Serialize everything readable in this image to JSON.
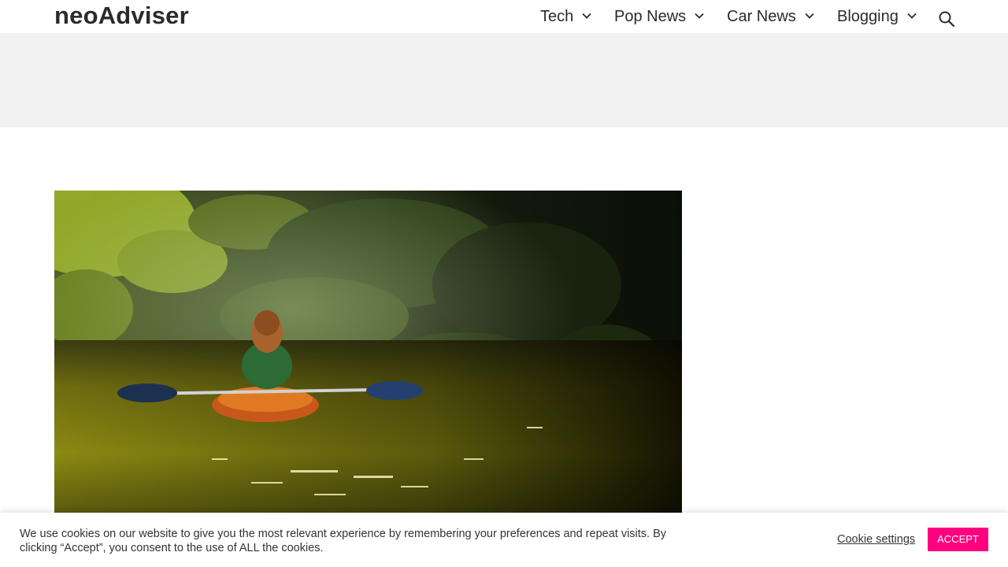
{
  "site": {
    "title": "neoAdviser"
  },
  "nav": {
    "items": [
      {
        "label": "Tech",
        "icon": "chevron-down-icon"
      },
      {
        "label": "Pop News",
        "icon": "chevron-down-icon"
      },
      {
        "label": "Car News",
        "icon": "chevron-down-icon"
      },
      {
        "label": "Blogging",
        "icon": "chevron-down-icon"
      }
    ],
    "search_icon": "search-icon"
  },
  "cookie": {
    "text": "We use cookies on our website to give you the most relevant experience by remembering your preferences and repeat visits. By clicking “Accept”, you consent to the use of ALL the cookies.",
    "settings_label": "Cookie settings",
    "accept_label": "ACCEPT",
    "accept_color": "#ff0080"
  },
  "colors": {
    "text": "#2b2b2b",
    "ad_band": "#f1f1f1"
  }
}
